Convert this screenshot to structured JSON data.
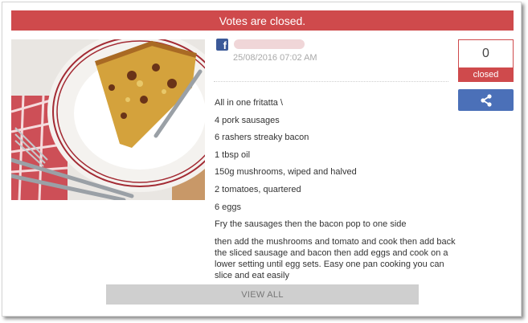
{
  "banner": {
    "text": "Votes are closed."
  },
  "post": {
    "image_alt": "fritatta-photo",
    "social_icon": "facebook-icon",
    "timestamp": "25/08/2016 07:02 AM",
    "lines": [
      "All in one fritatta \\",
      "4 pork sausages",
      "6 rashers streaky bacon",
      "1 tbsp oil",
      "150g mushrooms, wiped and halved",
      "2 tomatoes, quartered",
      "6 eggs",
      "Fry the sausages then the bacon pop to one side",
      "then add the mushrooms and tomato and cook then add back the sliced sausage and bacon then add eggs and cook on a lower setting until egg sets. Easy one pan cooking you can slice and eat easily"
    ]
  },
  "vote": {
    "count": "0",
    "status": "closed"
  },
  "share": {
    "icon": "share-icon"
  },
  "footer": {
    "view_all_label": "VIEW ALL"
  },
  "colors": {
    "accent": "#cf4a4c",
    "share": "#4b70b8",
    "facebook": "#3b5998"
  }
}
